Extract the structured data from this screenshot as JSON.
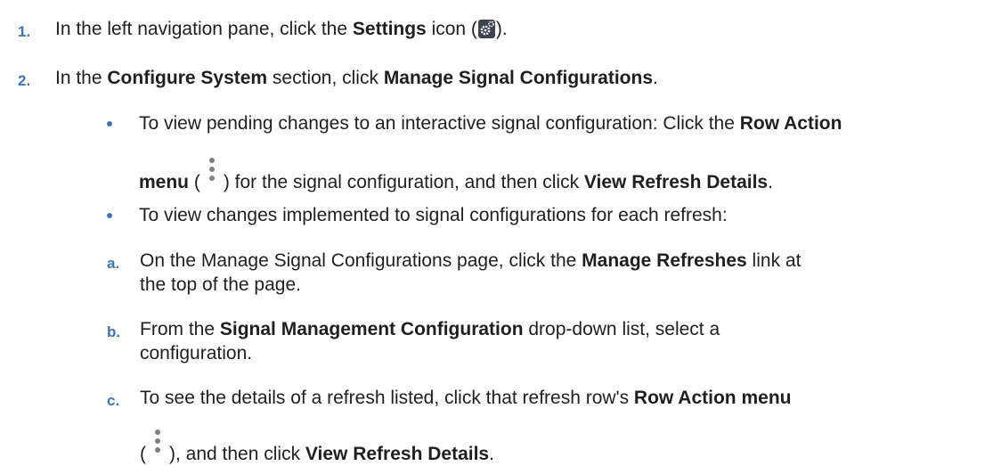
{
  "steps": [
    {
      "number": "1.",
      "text_1": "In the left navigation pane, click the ",
      "bold_1": "Settings",
      "text_2": " icon (",
      "icon": "settings-gear-icon",
      "text_3": ")."
    },
    {
      "number": "2.",
      "text_1": "In the ",
      "bold_1": "Configure System",
      "text_2": " section, click ",
      "bold_2": "Manage Signal Configurations",
      "text_3": "."
    }
  ],
  "bullets": [
    {
      "line1_text": "To view pending changes to an interactive signal configuration: Click the ",
      "line1_bold": "Row Action",
      "line2_bold": "menu",
      "line2_text_1": " (",
      "icon": "kebab-menu-icon",
      "line2_text_2": ") for the signal configuration, and then click ",
      "line2_bold_2": "View Refresh Details",
      "line2_text_3": "."
    },
    {
      "text": "To view changes implemented to signal configurations for each refresh:"
    }
  ],
  "substeps": [
    {
      "label": "a.",
      "line1_text": "On the Manage Signal Configurations page, click the ",
      "line1_bold": "Manage Refreshes",
      "line1_text_2": " link at",
      "line2_text": "the top of the page."
    },
    {
      "label": "b.",
      "line1_text": "From the ",
      "line1_bold": "Signal Management Configuration",
      "line1_text_2": " drop-down list, select a",
      "line2_text": "configuration."
    },
    {
      "label": "c.",
      "line1_text": "To see the details of a refresh listed, click that refresh row's ",
      "line1_bold": "Row Action menu",
      "line2_text_1": "(",
      "icon": "kebab-menu-icon",
      "line2_text_2": "), and then click ",
      "line2_bold": "View Refresh Details",
      "line2_text_3": "."
    }
  ]
}
